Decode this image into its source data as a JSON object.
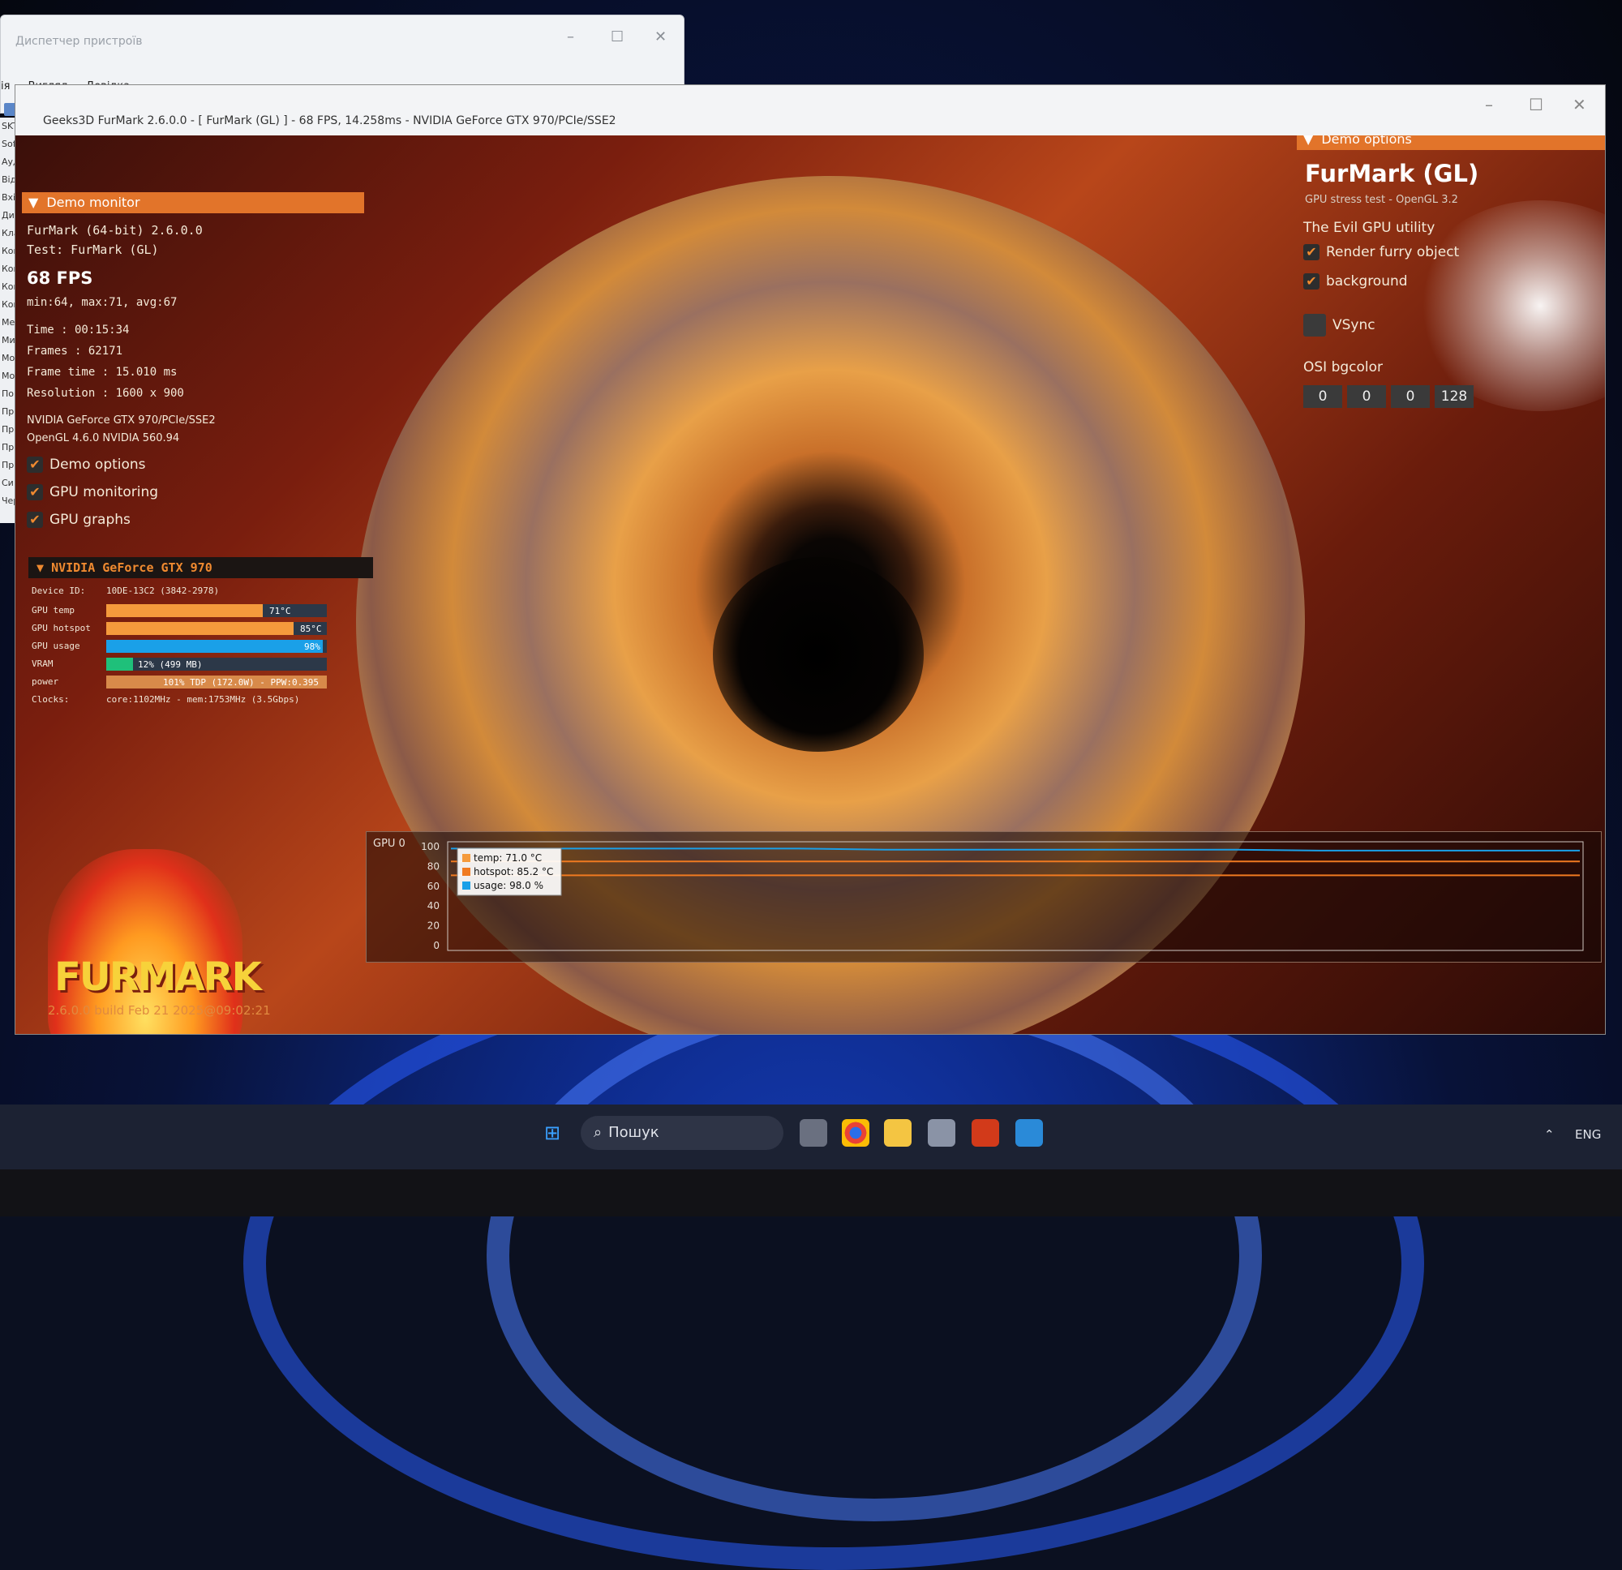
{
  "device_manager": {
    "title": "Диспетчер пристроїв",
    "menu": [
      "ія",
      "Вигляд",
      "Довідка"
    ],
    "left_labels": [
      "SKTO",
      "Sof",
      "Ауд",
      "Від",
      "Вхі",
      "Дис",
      "Кла",
      "Ком",
      "Ком",
      "Кон",
      "Кон",
      "Ме",
      "Ми",
      "Мо",
      "Мо",
      "По",
      "Пр",
      "Пр",
      "Пр",
      "Пр",
      "Си",
      "Чер"
    ]
  },
  "furmark_window": {
    "title": "Geeks3D FurMark 2.6.0.0 - [ FurMark (GL) ] - 68 FPS, 14.258ms - NVIDIA GeForce GTX 970/PCIe/SSE2"
  },
  "demo_monitor": {
    "header": "Demo monitor",
    "app_version": "FurMark (64-bit) 2.6.0.0",
    "test": "Test: FurMark (GL)",
    "fps": "68 FPS",
    "fps_stats": "min:64, max:71, avg:67",
    "time": "Time       : 00:15:34",
    "frames": "Frames     : 62171",
    "frame_time": "Frame time : 15.010 ms",
    "resolution": "Resolution : 1600 x 900",
    "gpu_name": "NVIDIA GeForce GTX 970/PCIe/SSE2",
    "opengl": "OpenGL 4.6.0 NVIDIA 560.94",
    "checkboxes": [
      {
        "label": "Demo options",
        "checked": true
      },
      {
        "label": "GPU monitoring",
        "checked": true
      },
      {
        "label": "GPU graphs",
        "checked": true
      }
    ]
  },
  "gpu_section": {
    "header": "NVIDIA GeForce GTX 970",
    "device_id_label": "Device ID:",
    "device_id_value": "10DE-13C2 (3842-2978)",
    "rows": [
      {
        "label": "GPU temp",
        "text": "71°C",
        "fraction": 0.71,
        "color": "#f59a3c"
      },
      {
        "label": "GPU hotspot",
        "text": "85°C",
        "fraction": 0.85,
        "color": "#f59a3c"
      },
      {
        "label": "GPU usage",
        "text": "98%",
        "fraction": 0.98,
        "color": "#1aa0e8"
      },
      {
        "label": "VRAM",
        "text": "12% (499 MB)",
        "fraction": 0.12,
        "color": "#1fc07a"
      },
      {
        "label": "power",
        "text": "101% TDP (172.0W) - PPW:0.395",
        "fraction": 1.0,
        "color": "#d88a4a"
      }
    ],
    "clocks_label": "Clocks:",
    "clocks_value": "core:1102MHz - mem:1753MHz (3.5Gbps)"
  },
  "logo": {
    "text": "FURMARK",
    "build": "2.6.0.0 build Feb 21 2025@09:02:21"
  },
  "demo_options": {
    "header": "Demo options",
    "title": "FurMark (GL)",
    "subtitle": "GPU stress test - OpenGL 3.2",
    "tagline": "The Evil GPU utility",
    "render_furry": "Render furry object",
    "background": "background",
    "vsync": "VSync",
    "osi_label": "OSI bgcolor",
    "osi_values": [
      "0",
      "0",
      "0",
      "128"
    ]
  },
  "chart_data": {
    "type": "line",
    "title": "GPU 0",
    "ylim": [
      0,
      100
    ],
    "yticks": [
      "100",
      "80",
      "60",
      "40",
      "20",
      "0"
    ],
    "legend": [
      "temp: 71.0 °C",
      "hotspot: 85.2 °C",
      "usage: 98.0 %"
    ],
    "series": [
      {
        "name": "usage",
        "color": "#1aa0e8",
        "values": [
          98,
          98,
          98,
          98,
          98,
          97,
          97,
          97,
          97,
          97,
          96,
          96,
          96,
          96
        ]
      },
      {
        "name": "hotspot",
        "color": "#f07a20",
        "values": [
          85,
          85,
          85,
          85,
          85,
          85,
          85,
          85,
          85,
          85,
          85,
          85,
          85,
          85
        ]
      },
      {
        "name": "temp",
        "color": "#f07a20",
        "values": [
          71,
          71,
          71,
          71,
          71,
          71,
          71,
          71,
          71,
          71,
          71,
          71,
          71,
          71
        ]
      }
    ]
  },
  "taskbar": {
    "search_placeholder": "Пошук",
    "language": "ENG"
  }
}
